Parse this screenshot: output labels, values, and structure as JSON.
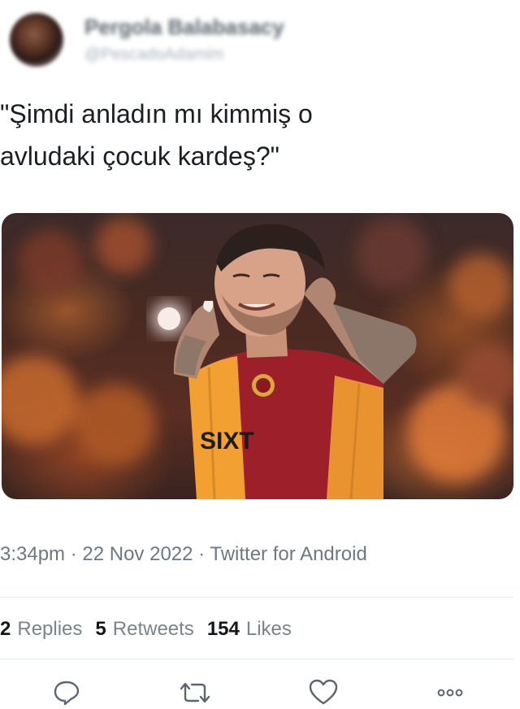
{
  "author": {
    "display_name": "Pergola Balabasacy",
    "handle": "@PescadoAdamim"
  },
  "tweet": {
    "text": "\"Şimdi anladın mı kimmiş o\navludaki çocuk kardeş?\"",
    "timestamp": "3:34pm · 22 Nov 2022 · Twitter for Android"
  },
  "stats": {
    "replies_count": "2",
    "replies_label": "Replies",
    "retweets_count": "5",
    "retweets_label": "Retweets",
    "likes_count": "154",
    "likes_label": "Likes"
  },
  "media": {
    "jersey_sponsor": "SIXT"
  },
  "actions": {
    "reply_icon": "speech-bubble-icon",
    "retweet_icon": "retweet-arrows-icon",
    "like_icon": "heart-icon",
    "more_icon": "ellipsis-icon"
  },
  "colors": {
    "icon": "#5b6670",
    "secondary_text": "#6e7882",
    "jersey_yellow": "#f2a031",
    "jersey_red": "#9c1f2a"
  }
}
